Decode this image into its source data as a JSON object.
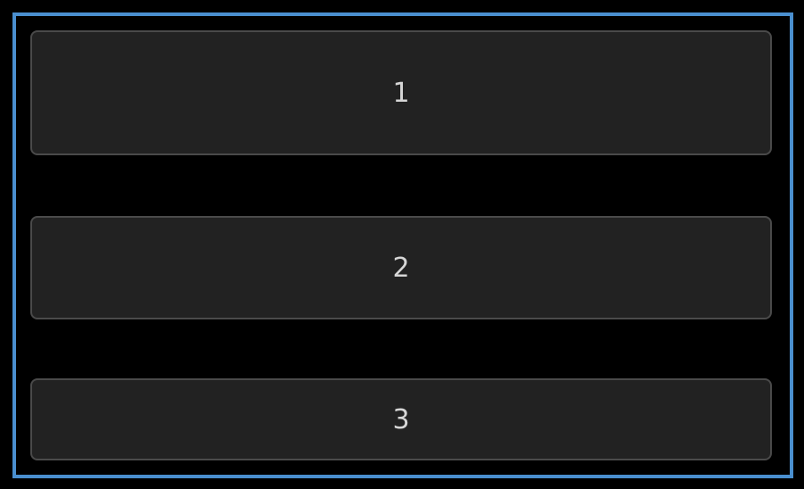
{
  "colors": {
    "background": "#000000",
    "frame_border": "#4a8fcf",
    "item_background": "#222222",
    "item_border": "#4a4a4a",
    "item_text": "#d6d6d6"
  },
  "items": [
    {
      "label": "1"
    },
    {
      "label": "2"
    },
    {
      "label": "3"
    }
  ]
}
